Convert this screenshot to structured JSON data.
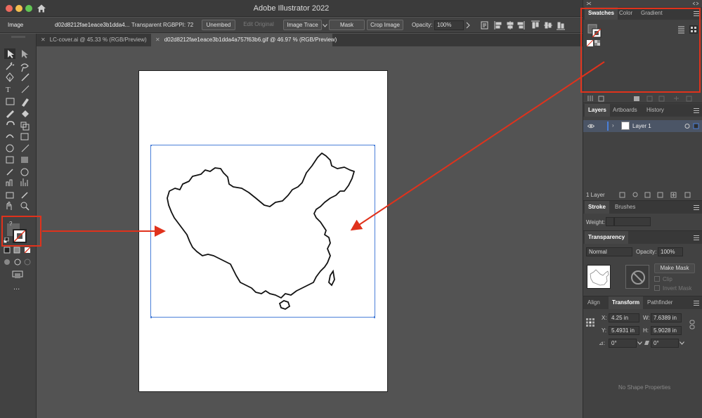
{
  "app": {
    "title": "Adobe Illustrator 2022"
  },
  "control_bar": {
    "type_label": "Image",
    "filename": "d02d8212fae1eace3b1dda4...",
    "color_mode": "Transparent RGB",
    "ppi": "PPI: 72",
    "unembed": "Unembed",
    "edit_original": "Edit Original",
    "image_trace": "Image Trace",
    "mask": "Mask",
    "crop_image": "Crop Image",
    "opacity_label": "Opacity:",
    "opacity_value": "100%"
  },
  "doc_tabs": [
    {
      "label": "LC-cover.ai @ 45.33 % (RGB/Preview)"
    },
    {
      "label": "d02d8212fae1eace3b1dda4a757f63b6.gif @ 46.97 % (RGB/Preview)"
    }
  ],
  "swatches_panel": {
    "tabs": [
      "Swatches",
      "Color",
      "Gradient"
    ]
  },
  "layers_panel": {
    "tabs": [
      "Layers",
      "Artboards",
      "History"
    ],
    "layer_name": "Layer 1",
    "layer_count": "1 Layer"
  },
  "stroke_panel": {
    "tabs": [
      "Stroke",
      "Brushes"
    ],
    "weight_label": "Weight:"
  },
  "transparency_panel": {
    "title": "Transparency",
    "blend_mode": "Normal",
    "opacity_label": "Opacity:",
    "opacity_value": "100%",
    "make_mask": "Make Mask",
    "clip": "Clip",
    "invert_mask": "Invert Mask"
  },
  "transform_panel": {
    "tabs": [
      "Align",
      "Transform",
      "Pathfinder"
    ],
    "x_label": "X:",
    "x_value": "4.25 in",
    "y_label": "Y:",
    "y_value": "5.4931 in",
    "w_label": "W:",
    "w_value": "7.6389 in",
    "h_label": "H:",
    "h_value": "5.9028 in",
    "angle_label": "⊿:",
    "angle_value": "0°",
    "shear_value": "0°",
    "no_shape": "No Shape Properties"
  },
  "toolbar": {
    "more": "..."
  },
  "colors": {
    "accent": "#e0321c",
    "selection": "#4a7fd8"
  }
}
